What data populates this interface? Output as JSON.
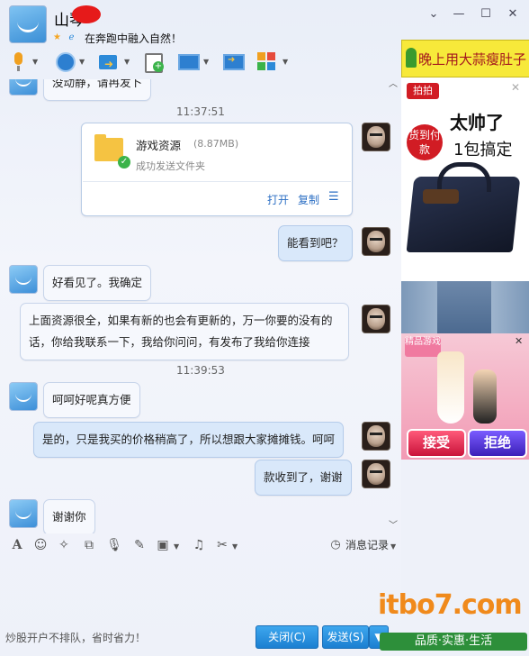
{
  "header": {
    "contact_name": "山琴",
    "status_message": "在奔跑中融入自然！"
  },
  "window_controls": {
    "menu": "⌄",
    "minimize": "—",
    "maximize": "☐",
    "close": "✕"
  },
  "toolbar": {
    "items": [
      "microphone-icon",
      "camera-icon",
      "send-file-icon",
      "add-contact-icon",
      "remote-desktop-icon",
      "share-screen-icon",
      "apps-icon"
    ]
  },
  "chat": {
    "partial_message": "没动静，请冉发卜",
    "time1": "11:37:51",
    "file_card": {
      "name": "游戏资源",
      "size": "(8.87MB)",
      "status": "成功发送文件夹",
      "open": "打开",
      "copy": "复制"
    },
    "msg_me_1": "能看到吧？",
    "msg_friend_1": "好看见了。我确定",
    "msg_friend_2": "上面资源很全，如果有新的也会有更新的，万一你要的没有的话，你给我联系一下，我给你问问，有发布了我给你连接",
    "time2": "11:39:53",
    "msg_friend_3": "呵呵好呢真方便",
    "msg_me_2": "是的，只是我买的价格稍高了，所以想跟大家摊摊钱。呵呵",
    "msg_me_3": "款收到了，谢谢",
    "msg_friend_4": "谢谢你"
  },
  "format_bar": {
    "history": "消息记录"
  },
  "bottom": {
    "tip": "炒股开户不排队，省时省力！",
    "close_button": "关闭(C)",
    "send_button": "发送(S)"
  },
  "ads": {
    "ad1": "晚上用大蒜瘦肚子",
    "ad2_badge": "拍拍",
    "ad2_cod": "货到付款",
    "ad2_headline": "太帅了",
    "ad2_sub": "1包搞定",
    "ad4_badge": "精品游戏",
    "ad4_accept": "接受",
    "ad4_reject": "拒绝"
  },
  "watermark": {
    "logo": "itbo7.com",
    "slogan": "品质·实惠·生活"
  }
}
